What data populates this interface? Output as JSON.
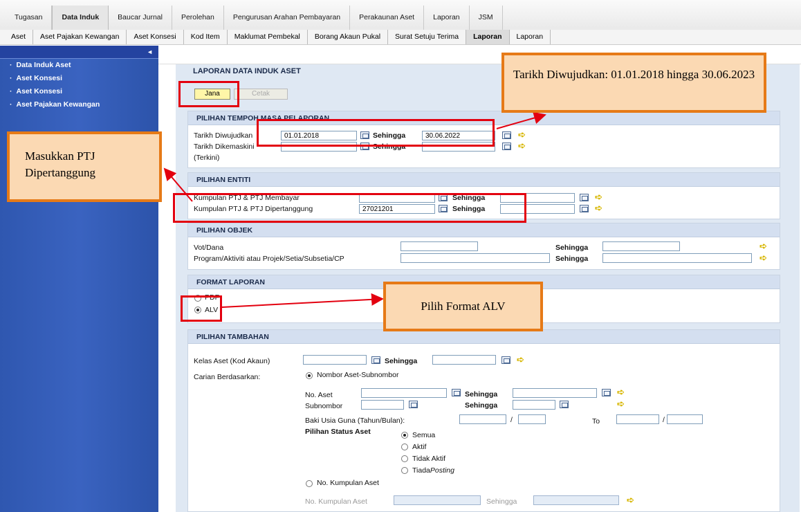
{
  "top_tabs": [
    "Tugasan",
    "Data Induk",
    "Baucar Jurnal",
    "Perolehan",
    "Pengurusan Arahan Pembayaran",
    "Perakaunan Aset",
    "Laporan",
    "JSM"
  ],
  "sub_tabs": [
    "Aset",
    "Aset Pajakan Kewangan",
    "Aset Konsesi",
    "Kod Item",
    "Maklumat Pembekal",
    "Borang Akaun Pukal",
    "Surat Setuju Terima",
    "Laporan",
    "Laporan"
  ],
  "sidebar": {
    "collapse": "◄",
    "items": [
      "Data Induk Aset",
      "Aset Konsesi",
      "Aset Konsesi",
      "Aset Pajakan Kewangan"
    ]
  },
  "page": {
    "title": "LAPORAN DATA INDUK ASET",
    "jana": "Jana",
    "cetak": "Cetak"
  },
  "tempoh": {
    "head": "PILIHAN TEMPOH MASA PELAPORAN",
    "diwujudkan": "Tarikh Diwujudkan",
    "dikemaskini": "Tarikh Dikemaskini",
    "terkini": "(Terkini)",
    "from": "01.01.2018",
    "to": "30.06.2022",
    "sehingga": "Sehingga"
  },
  "entiti": {
    "head": "PILIHAN ENTITI",
    "membayar": "Kumpulan PTJ & PTJ Membayar",
    "dipertanggung": "Kumpulan PTJ & PTJ Dipertanggung",
    "value": "27021201"
  },
  "objek": {
    "head": "PILIHAN OBJEK",
    "vot": "Vot/Dana",
    "program": "Program/Aktiviti atau Projek/Setia/Subsetia/CP"
  },
  "format": {
    "head": "FORMAT LAPORAN",
    "pdf": "PDF",
    "alv": "ALV"
  },
  "tambahan": {
    "head": "PILIHAN TAMBAHAN",
    "kelas": "Kelas Aset (Kod Akaun)",
    "carian": "Carian Berdasarkan:",
    "nombor": "Nombor Aset-Subnombor",
    "no_aset": "No. Aset",
    "subnombor": "Subnombor",
    "baki": "Baki Usia Guna (Tahun/Bulan):",
    "slash": "/",
    "to": "To",
    "status": "Pilihan Status Aset",
    "semua": "Semua",
    "aktif": "Aktif",
    "tidak_aktif": "Tidak Aktif",
    "tiada": "Tiada",
    "posting": "Posting",
    "no_kumpulan": "No. Kumpulan Aset"
  },
  "callouts": {
    "tarikh": "Tarikh Diwujudkan: 01.01.2018 hingga 30.06.2023",
    "ptj": "Masukkan PTJ Dipertanggung",
    "alv": "Pilih Format ALV"
  },
  "colors": {
    "sidebar": "#3a63c0",
    "highlight": "#e3000f",
    "callout_border": "#e67a17",
    "callout_fill": "#fbd9b3"
  }
}
